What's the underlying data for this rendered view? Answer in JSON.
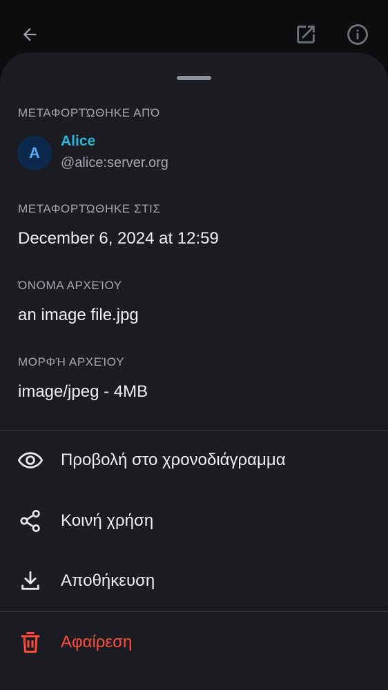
{
  "toolbar": {
    "back_icon": "arrow-back-icon",
    "open_external_icon": "open-external-icon",
    "info_icon": "info-icon"
  },
  "uploaded_by": {
    "label": "ΜΕΤΑΦΟΡΤΏΘΗΚΕ ΑΠΌ",
    "avatar_initial": "A",
    "name": "Alice",
    "user_id": "@alice:server.org"
  },
  "uploaded_on": {
    "label": "ΜΕΤΑΦΟΡΤΏΘΗΚΕ ΣΤΙΣ",
    "value": "December 6, 2024 at 12:59"
  },
  "file_name": {
    "label": "ΌΝΟΜΑ ΑΡΧΕΊΟΥ",
    "value": "an image file.jpg"
  },
  "file_format": {
    "label": "ΜΟΡΦΉ ΑΡΧΕΊΟΥ",
    "value": "image/jpeg - 4MB"
  },
  "actions": {
    "view_in_timeline": "Προβολή στο χρονοδιάγραμμα",
    "share": "Κοινή χρήση",
    "save": "Αποθήκευση",
    "remove": "Αφαίρεση"
  },
  "colors": {
    "background": "#0d0e10",
    "sheet": "#1b1d22",
    "accent_name": "#29b6d6",
    "danger": "#ff4a3d"
  }
}
